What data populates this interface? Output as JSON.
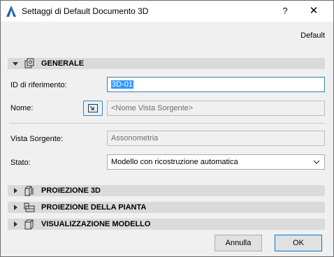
{
  "window": {
    "title": "Settaggi di Default Documento 3D",
    "help_label": "?",
    "close_label": "✕"
  },
  "preset": {
    "label": "Default"
  },
  "sections": {
    "generale": {
      "label": "GENERALE",
      "expanded": true
    },
    "proiezione_3d": {
      "label": "PROIEZIONE 3D",
      "expanded": false
    },
    "proiezione_pianta": {
      "label": "PROIEZIONE DELLA PIANTA",
      "expanded": false
    },
    "visualizzazione_modello": {
      "label": "VISUALIZZAZIONE MODELLO",
      "expanded": false
    }
  },
  "form": {
    "id_label": "ID di riferimento:",
    "id_value": "3D-01",
    "name_label": "Nome:",
    "name_value": "<Nome Vista Sorgente>",
    "source_label": "Vista Sorgente:",
    "source_value": "Assonometria",
    "state_label": "Stato:",
    "state_value": "Modello con ricostruzione automatica"
  },
  "buttons": {
    "cancel_label": "Annulla",
    "ok_label": "OK"
  },
  "colors": {
    "selection": "#3399ff",
    "focus_border": "#3c7fb1",
    "section_bg": "#dadada"
  }
}
